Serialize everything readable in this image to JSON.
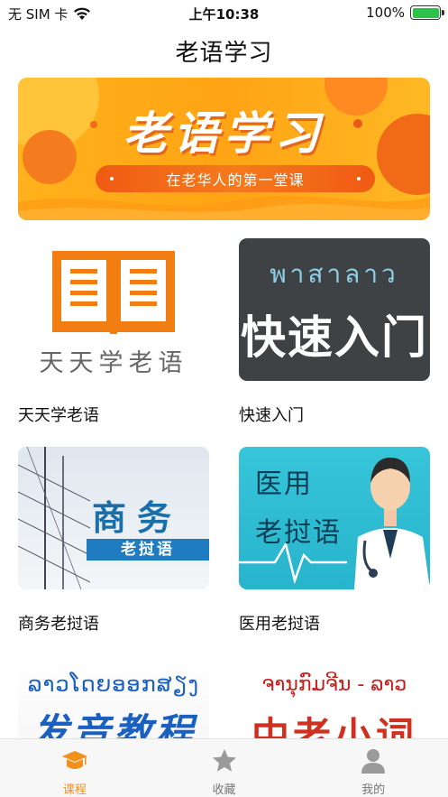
{
  "status_bar": {
    "carrier": "无 SIM 卡",
    "time": "上午10:38",
    "battery": "100%",
    "battery_level": 1.0
  },
  "nav": {
    "title": "老语学习"
  },
  "banner": {
    "title": "老语学习",
    "subtitle": "在老华人的第一堂课"
  },
  "courses": [
    {
      "label": "天天学老语",
      "thumb_text": "天天学老语"
    },
    {
      "label": "快速入门",
      "thumb_lao": "พาสาลาว",
      "thumb_big": "快速入门"
    },
    {
      "label": "商务老挝语",
      "thumb_big": "商务",
      "thumb_bar": "老挝语"
    },
    {
      "label": "医用老挝语",
      "thumb_line1": "医用",
      "thumb_line2": "老挝语"
    },
    {
      "label": "",
      "thumb_lao": "ລາວໂດຍອອກສຽງ",
      "thumb_big": "发音教程"
    },
    {
      "label": "",
      "thumb_lao": "ຈານຸກົມຈີນ - ລາວ",
      "thumb_big": "中老小词典"
    }
  ],
  "tabs": [
    {
      "label": "课程",
      "icon": "graduation-cap-icon",
      "active": true
    },
    {
      "label": "收藏",
      "icon": "star-icon",
      "active": false
    },
    {
      "label": "我的",
      "icon": "person-icon",
      "active": false
    }
  ],
  "colors": {
    "accent": "#f2901c",
    "banner_orange": "#ffa414",
    "tab_inactive": "#777777"
  }
}
